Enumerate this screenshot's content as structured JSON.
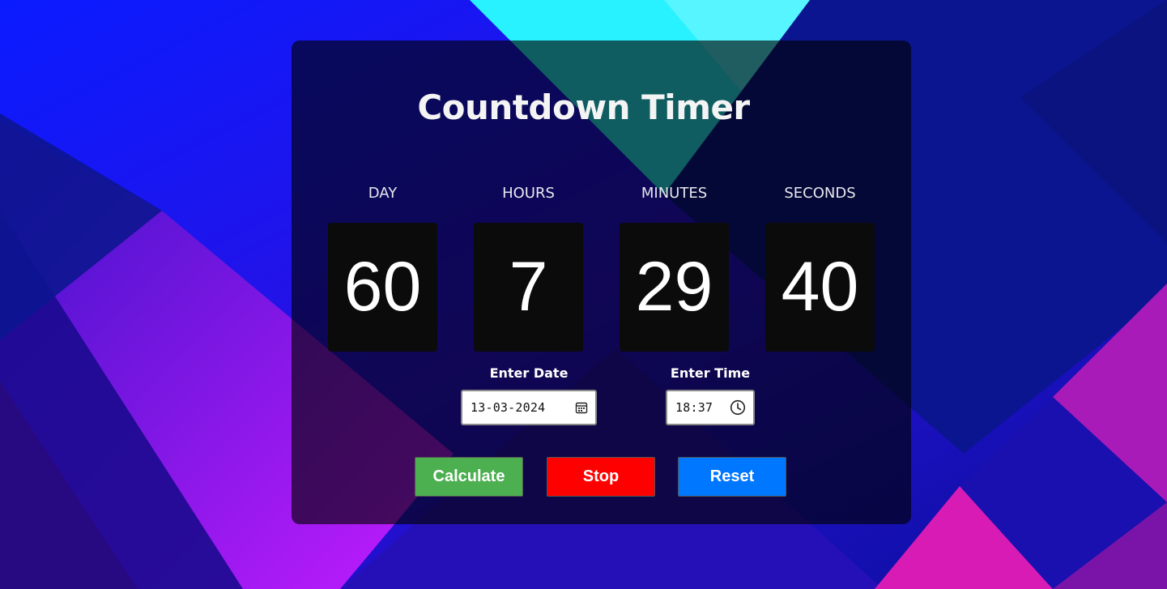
{
  "title": "Countdown Timer",
  "units": [
    {
      "label": "DAY",
      "value": "60"
    },
    {
      "label": "HOURS",
      "value": "7"
    },
    {
      "label": "MINUTES",
      "value": "29"
    },
    {
      "label": "SECONDS",
      "value": "40"
    }
  ],
  "date_field": {
    "label": "Enter Date",
    "value": "13-03-2024",
    "icon": "calendar-icon"
  },
  "time_field": {
    "label": "Enter Time",
    "value": "18:37",
    "icon": "clock-icon"
  },
  "buttons": {
    "calculate": {
      "label": "Calculate",
      "color": "#4caf50"
    },
    "stop": {
      "label": "Stop",
      "color": "#ff0000"
    },
    "reset": {
      "label": "Reset",
      "color": "#0077ff"
    }
  },
  "colors": {
    "card_bg": "#000000",
    "digit_box": "#0b0b0b",
    "text": "#ffffff"
  }
}
